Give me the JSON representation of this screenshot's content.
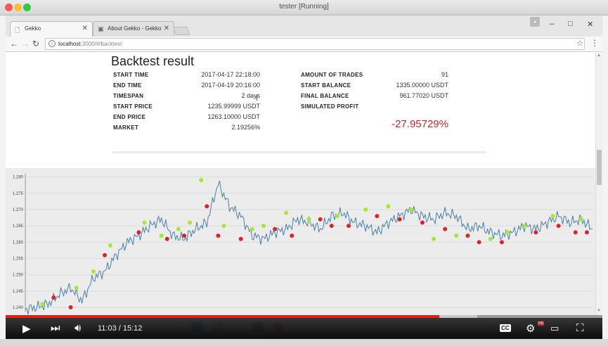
{
  "vm_window": {
    "title": "tester [Running]",
    "traffic_colors": [
      "#fc5753",
      "#fdbc40",
      "#33c748"
    ]
  },
  "browser": {
    "tabs": [
      {
        "label": "Gekko",
        "icon": "page-icon",
        "active": true
      },
      {
        "label": "About Gekko - Gekko",
        "icon": "gekko-favicon",
        "active": false
      }
    ],
    "url_host": "localhost",
    "url_path": ":3000/#/backtest",
    "window_controls": [
      "–",
      "□",
      "✕"
    ]
  },
  "page": {
    "title": "Backtest result",
    "left_stats": [
      {
        "label": "START TIME",
        "value": "2017-04-17 22:18:00"
      },
      {
        "label": "END TIME",
        "value": "2017-04-19 20:16:00"
      },
      {
        "label": "TIMESPAN",
        "value": "2 days"
      },
      {
        "label": "START PRICE",
        "value": "1235.99999 USDT"
      },
      {
        "label": "END PRICE",
        "value": "1263.10000 USDT"
      },
      {
        "label": "MARKET",
        "value": "2.19256%"
      }
    ],
    "right_stats": [
      {
        "label": "AMOUNT OF TRADES",
        "value": "91"
      },
      {
        "label": "START BALANCE",
        "value": "1335.00000 USDT"
      },
      {
        "label": "FINAL BALANCE",
        "value": "961.77020 USDT"
      },
      {
        "label": "SIMULATED PROFIT",
        "value": ""
      }
    ],
    "simulated_profit": "-27.95729%",
    "profit_color": "#c0262d"
  },
  "chart_data": {
    "type": "line",
    "y_ticks": [
      "1.280",
      "1.275",
      "1.270",
      "1.265",
      "1.260",
      "1.255",
      "1.250",
      "1.245",
      "1.240"
    ],
    "ylim": [
      1.2385,
      1.281
    ],
    "xlim": [
      0,
      100
    ],
    "line_color": "#4a7fa8",
    "buy_color": "#a5e834",
    "sell_color": "#d9242b",
    "grid": true,
    "x": [
      0,
      2,
      4,
      6,
      8,
      10,
      12,
      14,
      16,
      18,
      20,
      22,
      24,
      26,
      28,
      30,
      32,
      34,
      36,
      38,
      40,
      42,
      44,
      46,
      48,
      50,
      52,
      54,
      56,
      58,
      60,
      62,
      64,
      66,
      68,
      70,
      72,
      74,
      76,
      78,
      80,
      82,
      84,
      86,
      88,
      90,
      92,
      94,
      96,
      98,
      100
    ],
    "y": [
      1.2395,
      1.24,
      1.241,
      1.244,
      1.246,
      1.242,
      1.249,
      1.251,
      1.256,
      1.26,
      1.262,
      1.265,
      1.267,
      1.262,
      1.261,
      1.264,
      1.266,
      1.278,
      1.271,
      1.268,
      1.262,
      1.261,
      1.263,
      1.264,
      1.267,
      1.266,
      1.264,
      1.268,
      1.269,
      1.266,
      1.265,
      1.263,
      1.266,
      1.268,
      1.27,
      1.268,
      1.267,
      1.269,
      1.268,
      1.264,
      1.265,
      1.263,
      1.262,
      1.263,
      1.265,
      1.264,
      1.266,
      1.268,
      1.266,
      1.267,
      1.264
    ],
    "buys": [
      [
        3,
        1.241
      ],
      [
        9,
        1.246
      ],
      [
        12,
        1.251
      ],
      [
        15,
        1.259
      ],
      [
        21,
        1.266
      ],
      [
        24,
        1.262
      ],
      [
        27,
        1.264
      ],
      [
        29,
        1.266
      ],
      [
        31,
        1.279
      ],
      [
        35,
        1.265
      ],
      [
        40,
        1.264
      ],
      [
        42,
        1.265
      ],
      [
        46,
        1.269
      ],
      [
        50,
        1.267
      ],
      [
        55,
        1.268
      ],
      [
        60,
        1.27
      ],
      [
        64,
        1.271
      ],
      [
        68,
        1.27
      ],
      [
        72,
        1.261
      ],
      [
        76,
        1.262
      ],
      [
        82,
        1.261
      ],
      [
        85,
        1.263
      ],
      [
        88,
        1.265
      ],
      [
        93,
        1.268
      ],
      [
        98,
        1.267
      ]
    ],
    "sells": [
      [
        5,
        1.243
      ],
      [
        8,
        1.24
      ],
      [
        14,
        1.256
      ],
      [
        20,
        1.263
      ],
      [
        25,
        1.261
      ],
      [
        28,
        1.262
      ],
      [
        32,
        1.271
      ],
      [
        34,
        1.262
      ],
      [
        38,
        1.261
      ],
      [
        44,
        1.264
      ],
      [
        47,
        1.262
      ],
      [
        52,
        1.267
      ],
      [
        54,
        1.265
      ],
      [
        57,
        1.265
      ],
      [
        62,
        1.268
      ],
      [
        66,
        1.267
      ],
      [
        70,
        1.266
      ],
      [
        74,
        1.264
      ],
      [
        78,
        1.262
      ],
      [
        80,
        1.26
      ],
      [
        84,
        1.26
      ],
      [
        90,
        1.263
      ],
      [
        94,
        1.265
      ],
      [
        97,
        1.263
      ],
      [
        99,
        1.263
      ]
    ]
  },
  "player": {
    "current_time": "11:03",
    "duration": "15:12",
    "time_display": "11:03 / 15:12",
    "progress": 0.727,
    "buffered": 0.79,
    "cc_label": "CC",
    "hd_label": "HD"
  }
}
